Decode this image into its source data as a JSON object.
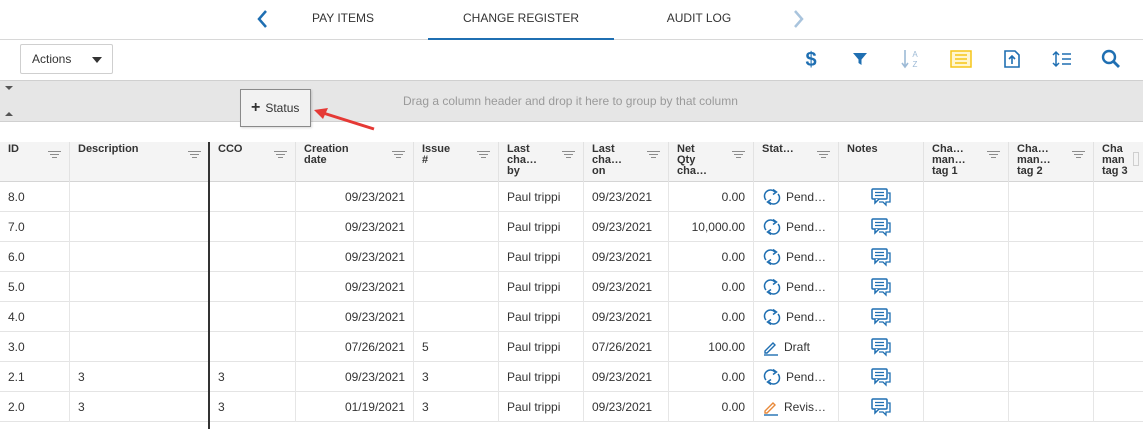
{
  "tabs": {
    "items": [
      {
        "label": "PAY ITEMS",
        "active": false
      },
      {
        "label": "CHANGE REGISTER",
        "active": true
      },
      {
        "label": "AUDIT LOG",
        "active": false
      }
    ],
    "prev_icon": "chevron-left-icon",
    "next_icon": "chevron-right-icon"
  },
  "toolbar": {
    "actions_label": "Actions",
    "icons": [
      "dollar-icon",
      "filter-icon",
      "sort-az-icon",
      "list-view-icon",
      "export-icon",
      "line-spacing-icon",
      "search-icon"
    ],
    "accent_color": "#1f6fb2",
    "inactive_color": "#9dbad6",
    "highlight_color": "#f5c518"
  },
  "group_panel": {
    "hint": "Drag a column header and drop it here to group by that column",
    "dragged_chip": {
      "plus": "+",
      "label": "Status"
    },
    "arrow_color": "#e53935"
  },
  "grid": {
    "columns": [
      "ID",
      "Description",
      "CCO",
      "Creation\ndate",
      "Issue\n#",
      "Last\ncha…\nby",
      "Last\ncha…\non",
      "Net\nQty\ncha…",
      "Stat…",
      "Notes",
      "Cha…\nman…\ntag 1",
      "Cha…\nman…\ntag 2",
      "Cha\nman\ntag 3"
    ],
    "rows": [
      {
        "id": "8.0",
        "description": "",
        "cco": "",
        "creation_date": "09/23/2021",
        "issue": "",
        "last_changed_by": "Paul trippi",
        "last_changed_on": "09/23/2021",
        "net_qty": "0.00",
        "status": "Pend…",
        "status_icon": "pending-sync-icon"
      },
      {
        "id": "7.0",
        "description": "",
        "cco": "",
        "creation_date": "09/23/2021",
        "issue": "",
        "last_changed_by": "Paul trippi",
        "last_changed_on": "09/23/2021",
        "net_qty": "10,000.00",
        "status": "Pend…",
        "status_icon": "pending-sync-icon"
      },
      {
        "id": "6.0",
        "description": "",
        "cco": "",
        "creation_date": "09/23/2021",
        "issue": "",
        "last_changed_by": "Paul trippi",
        "last_changed_on": "09/23/2021",
        "net_qty": "0.00",
        "status": "Pend…",
        "status_icon": "pending-sync-icon"
      },
      {
        "id": "5.0",
        "description": "",
        "cco": "",
        "creation_date": "09/23/2021",
        "issue": "",
        "last_changed_by": "Paul trippi",
        "last_changed_on": "09/23/2021",
        "net_qty": "0.00",
        "status": "Pend…",
        "status_icon": "pending-sync-icon"
      },
      {
        "id": "4.0",
        "description": "",
        "cco": "",
        "creation_date": "09/23/2021",
        "issue": "",
        "last_changed_by": "Paul trippi",
        "last_changed_on": "09/23/2021",
        "net_qty": "0.00",
        "status": "Pend…",
        "status_icon": "pending-sync-icon"
      },
      {
        "id": "3.0",
        "description": "",
        "cco": "",
        "creation_date": "07/26/2021",
        "issue": "5",
        "last_changed_by": "Paul trippi",
        "last_changed_on": "07/26/2021",
        "net_qty": "100.00",
        "status": "Draft",
        "status_icon": "pencil-icon"
      },
      {
        "id": "2.1",
        "description": "3",
        "cco": "3",
        "creation_date": "09/23/2021",
        "issue": "3",
        "last_changed_by": "Paul trippi",
        "last_changed_on": "09/23/2021",
        "net_qty": "0.00",
        "status": "Pend…",
        "status_icon": "pending-sync-icon"
      },
      {
        "id": "2.0",
        "description": "3",
        "cco": "3",
        "creation_date": "01/19/2021",
        "issue": "3",
        "last_changed_by": "Paul trippi",
        "last_changed_on": "09/23/2021",
        "net_qty": "0.00",
        "status": "Revis…",
        "status_icon": "revise-pencil-icon"
      }
    ],
    "notes_icon": "comment-icon"
  }
}
